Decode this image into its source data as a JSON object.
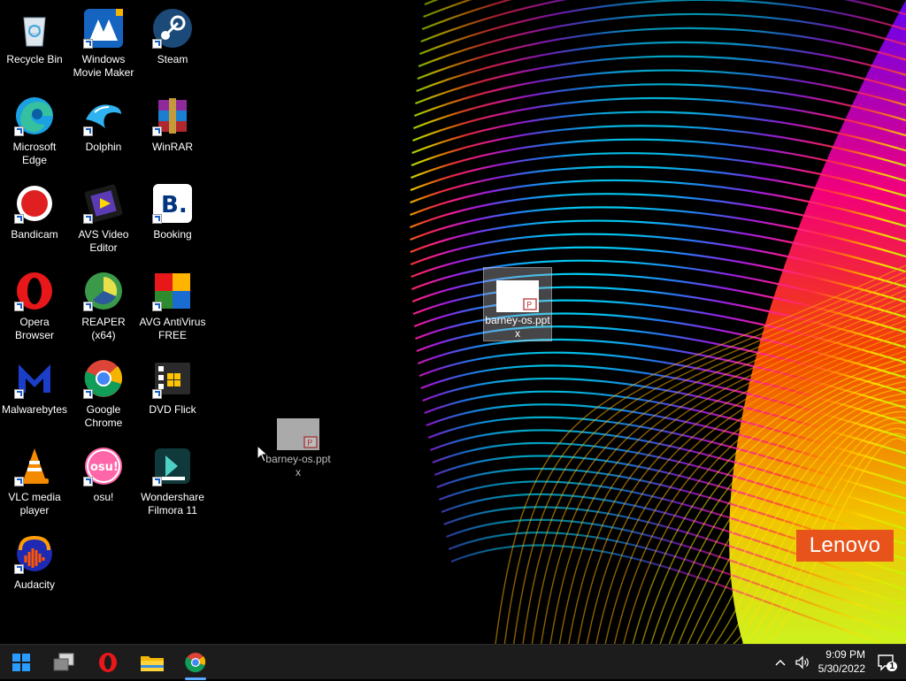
{
  "desktop": {
    "icons": [
      {
        "id": "recycle-bin",
        "label": "Recycle Bin",
        "icon": "recycle-bin-icon"
      },
      {
        "id": "windows-movie-maker",
        "label": "Windows\nMovie Maker",
        "icon": "movie-maker-icon"
      },
      {
        "id": "steam",
        "label": "Steam",
        "icon": "steam-icon"
      },
      {
        "id": "microsoft-edge",
        "label": "Microsoft\nEdge",
        "icon": "edge-icon"
      },
      {
        "id": "dolphin",
        "label": "Dolphin",
        "icon": "dolphin-icon"
      },
      {
        "id": "winrar",
        "label": "WinRAR",
        "icon": "winrar-icon"
      },
      {
        "id": "bandicam",
        "label": "Bandicam",
        "icon": "bandicam-icon"
      },
      {
        "id": "avs-video-editor",
        "label": "AVS Video\nEditor",
        "icon": "avs-video-editor-icon"
      },
      {
        "id": "booking",
        "label": "Booking",
        "icon": "booking-icon"
      },
      {
        "id": "opera-browser",
        "label": "Opera\nBrowser",
        "icon": "opera-icon"
      },
      {
        "id": "reaper",
        "label": "REAPER (x64)",
        "icon": "reaper-icon"
      },
      {
        "id": "avg-antivirus",
        "label": "AVG AntiVirus\nFREE",
        "icon": "avg-icon"
      },
      {
        "id": "malwarebytes",
        "label": "Malwarebytes",
        "icon": "malwarebytes-icon"
      },
      {
        "id": "google-chrome",
        "label": "Google\nChrome",
        "icon": "chrome-icon"
      },
      {
        "id": "dvd-flick",
        "label": "DVD Flick",
        "icon": "dvd-flick-icon"
      },
      {
        "id": "vlc",
        "label": "VLC media\nplayer",
        "icon": "vlc-icon"
      },
      {
        "id": "osu",
        "label": "osu!",
        "icon": "osu-icon"
      },
      {
        "id": "filmora",
        "label": "Wondershare\nFilmora 11",
        "icon": "filmora-icon"
      },
      {
        "id": "audacity",
        "label": "Audacity",
        "icon": "audacity-icon"
      }
    ],
    "file_selected": {
      "label": "barney-os.ppt\nx",
      "icon": "pptx-file-icon"
    },
    "file_dragging": {
      "label": "barney-os.ppt\nx",
      "icon": "pptx-file-icon"
    },
    "osu_text": "osu!",
    "booking_text": "B."
  },
  "brand": {
    "logo_text": "Lenovo",
    "color": "#e8531c"
  },
  "taskbar": {
    "items": [
      {
        "id": "start",
        "icon": "windows-start-icon"
      },
      {
        "id": "task-view",
        "icon": "task-view-icon"
      },
      {
        "id": "opera",
        "icon": "opera-icon"
      },
      {
        "id": "file-explorer",
        "icon": "file-explorer-icon"
      },
      {
        "id": "chrome",
        "icon": "chrome-icon",
        "active": true
      }
    ],
    "tray": {
      "time": "9:09 PM",
      "date": "5/30/2022",
      "icons": [
        "chevron-up-icon",
        "volume-icon",
        "notification-icon"
      ],
      "notification_count": "1"
    }
  },
  "colors": {
    "taskbar": "#1c1c1c",
    "accent": "#0078d4",
    "lenovo": "#e8531c"
  }
}
